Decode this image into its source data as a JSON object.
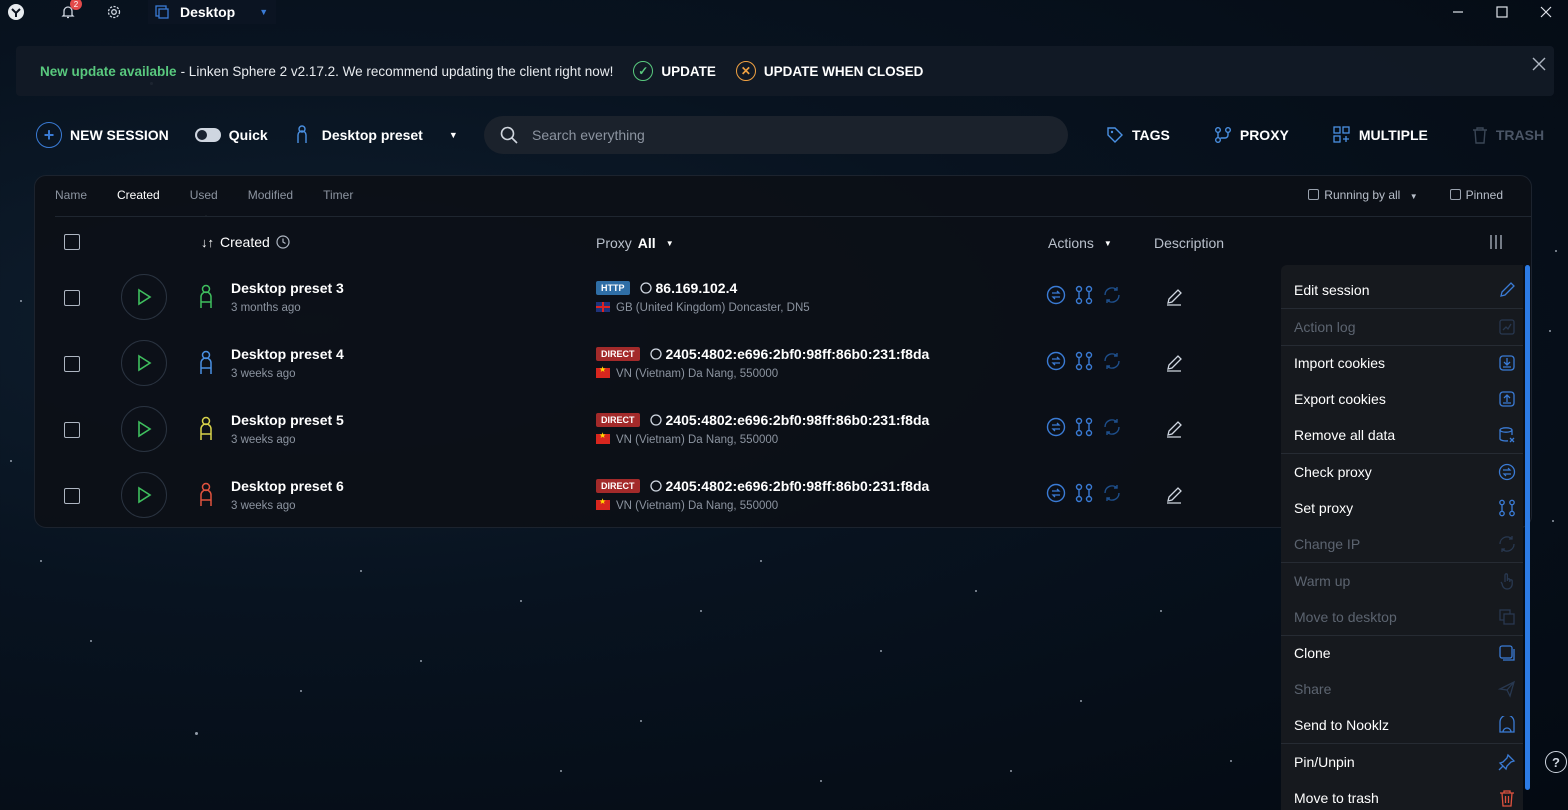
{
  "titlebar": {
    "notifications_count": "2",
    "workspace_label": "Desktop"
  },
  "banner": {
    "highlight": "New update available",
    "message": "- Linken Sphere 2 v2.17.2.  We recommend updating the client right now!",
    "update_label": "UPDATE",
    "update_closed_label": "UPDATE WHEN CLOSED"
  },
  "toolbar": {
    "new_session_label": "NEW SESSION",
    "quick_label": "Quick",
    "preset_label": "Desktop preset",
    "search_placeholder": "Search everything",
    "tags_label": "TAGS",
    "proxy_label": "PROXY",
    "multiple_label": "MULTIPLE",
    "trash_label": "TRASH"
  },
  "sort_tabs": [
    "Name",
    "Created",
    "Used",
    "Modified",
    "Timer"
  ],
  "filters": {
    "running_label": "Running by all",
    "pinned_label": "Pinned"
  },
  "columns": {
    "created": "Created",
    "proxy": "Proxy",
    "proxy_filter": "All",
    "actions": "Actions",
    "description": "Description"
  },
  "sessions": [
    {
      "name": "Desktop preset 3",
      "time": "3 months ago",
      "proxy_type": "HTTP",
      "address": "86.169.102.4",
      "location": "GB (United Kingdom) Doncaster, DN5",
      "flag": "gb",
      "icon_color": "#3fbf5e"
    },
    {
      "name": "Desktop preset 4",
      "time": "3 weeks ago",
      "proxy_type": "DIRECT",
      "address": "2405:4802:e696:2bf0:98ff:86b0:231:f8da",
      "location": "VN (Vietnam) Da Nang, 550000",
      "flag": "vn",
      "icon_color": "#4a90e2"
    },
    {
      "name": "Desktop preset 5",
      "time": "3 weeks ago",
      "proxy_type": "DIRECT",
      "address": "2405:4802:e696:2bf0:98ff:86b0:231:f8da",
      "location": "VN (Vietnam) Da Nang, 550000",
      "flag": "vn",
      "icon_color": "#d8d24a"
    },
    {
      "name": "Desktop preset 6",
      "time": "3 weeks ago",
      "proxy_type": "DIRECT",
      "address": "2405:4802:e696:2bf0:98ff:86b0:231:f8da",
      "location": "VN (Vietnam) Da Nang, 550000",
      "flag": "vn",
      "icon_color": "#e0523e"
    }
  ],
  "context_menu": [
    {
      "label": "Edit session",
      "enabled": true,
      "icon": "pencil-icon"
    },
    {
      "label": "Action log",
      "enabled": false,
      "icon": "log-icon"
    },
    {
      "label": "Import cookies",
      "enabled": true,
      "icon": "import-icon"
    },
    {
      "label": "Export cookies",
      "enabled": true,
      "icon": "export-icon"
    },
    {
      "label": "Remove all data",
      "enabled": true,
      "icon": "database-remove-icon"
    },
    {
      "label": "Check proxy",
      "enabled": true,
      "icon": "check-proxy-icon"
    },
    {
      "label": "Set proxy",
      "enabled": true,
      "icon": "set-proxy-icon"
    },
    {
      "label": "Change IP",
      "enabled": false,
      "icon": "refresh-icon"
    },
    {
      "label": "Warm up",
      "enabled": false,
      "icon": "hand-icon"
    },
    {
      "label": "Move to desktop",
      "enabled": false,
      "icon": "desktop-icon"
    },
    {
      "label": "Clone",
      "enabled": true,
      "icon": "clone-icon"
    },
    {
      "label": "Share",
      "enabled": false,
      "icon": "send-icon"
    },
    {
      "label": "Send to Nooklz",
      "enabled": true,
      "icon": "nooklz-icon"
    },
    {
      "label": "Pin/Unpin",
      "enabled": true,
      "icon": "pin-icon"
    },
    {
      "label": "Move to trash",
      "enabled": true,
      "icon": "trash-icon"
    }
  ],
  "colors": {
    "accent": "#3a7bd5",
    "success": "#59c97e",
    "warning": "#f0a142",
    "danger": "#e0523e"
  }
}
